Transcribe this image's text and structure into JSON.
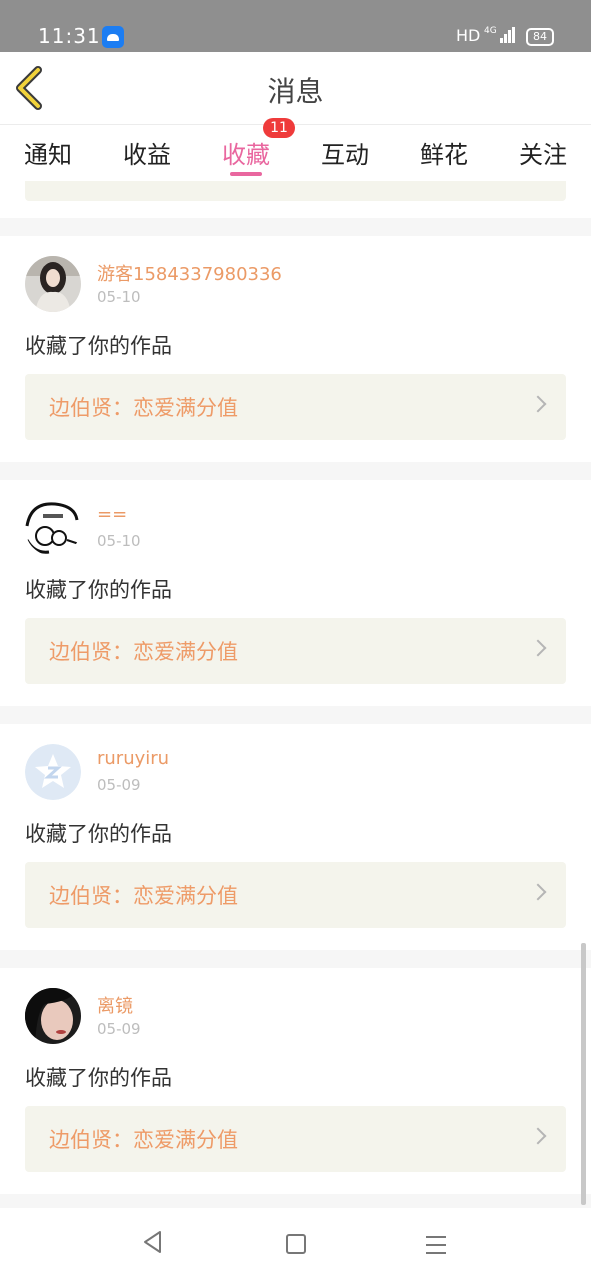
{
  "status_bar": {
    "time": "11:31",
    "hd": "HD",
    "network": "4G",
    "battery": "84"
  },
  "header": {
    "title": "消息"
  },
  "tabs": [
    {
      "label": "通知"
    },
    {
      "label": "收益"
    },
    {
      "label": "收藏",
      "badge": "11",
      "active": true
    },
    {
      "label": "互动"
    },
    {
      "label": "鲜花"
    },
    {
      "label": "关注"
    }
  ],
  "messages": [
    {
      "username": "游客1584337980336",
      "date": "05-10",
      "action": "收藏了你的作品",
      "work_title": "边伯贤：恋爱满分值",
      "avatar": "girl-photo-avatar"
    },
    {
      "username": "==",
      "date": "05-10",
      "action": "收藏了你的作品",
      "work_title": "边伯贤：恋爱满分值",
      "avatar": "cartoon-sketch-avatar"
    },
    {
      "username": "ruruyiru",
      "date": "05-09",
      "action": "收藏了你的作品",
      "work_title": "边伯贤：恋爱满分值",
      "avatar": "default-star-avatar"
    },
    {
      "username": "离镜",
      "date": "05-09",
      "action": "收藏了你的作品",
      "work_title": "边伯贤：恋爱满分值",
      "avatar": "portrait-photo-avatar"
    }
  ],
  "colors": {
    "accent": "#e9679f",
    "username": "#eb9a66",
    "card_bg": "#f4f4ec",
    "badge": "#ef3b3b"
  }
}
